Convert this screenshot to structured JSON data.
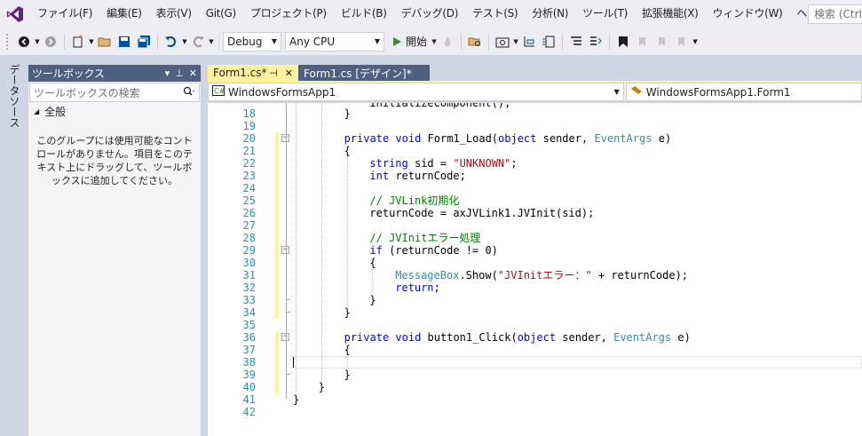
{
  "menu": {
    "items": [
      "ファイル(F)",
      "編集(E)",
      "表示(V)",
      "Git(G)",
      "プロジェクト(P)",
      "ビルド(B)",
      "デバッグ(D)",
      "テスト(S)",
      "分析(N)",
      "ツール(T)",
      "拡張機能(X)",
      "ウィンドウ(W)",
      "ヘルプ(H)"
    ],
    "search_placeholder": "検索 (Ctrl+"
  },
  "toolbar": {
    "configuration": "Debug",
    "platform": "Any CPU",
    "start_label": "開始"
  },
  "side_strip": {
    "data_source_label": "データソース"
  },
  "toolbox": {
    "title": "ツールボックス",
    "search_placeholder": "ツールボックスの検索",
    "group_label": "全般",
    "empty_message": "このグループには使用可能なコントロールがありません。項目をこのテキスト上にドラッグして、ツールボックスに追加してください。"
  },
  "tabs": [
    {
      "label": "Form1.cs*",
      "active": true
    },
    {
      "label": "Form1.cs [デザイン]*",
      "active": false
    }
  ],
  "navbar": {
    "project": "WindowsFormsApp1",
    "class": "WindowsFormsApp1.Form1"
  },
  "editor": {
    "line_numbers": [
      "18",
      "19",
      "20",
      "21",
      "22",
      "23",
      "24",
      "25",
      "26",
      "27",
      "28",
      "29",
      "30",
      "31",
      "32",
      "33",
      "34",
      "35",
      "36",
      "37",
      "38",
      "39",
      "40",
      "41",
      "42"
    ],
    "top_partial_line": "InitializeComponent();",
    "lines": [
      {
        "n": "18",
        "text": "}"
      },
      {
        "n": "19",
        "text": ""
      },
      {
        "n": "20",
        "text": "private void Form1_Load(object sender, EventArgs e)"
      },
      {
        "n": "21",
        "text": "{"
      },
      {
        "n": "22",
        "text": "string sid = \"UNKNOWN\";"
      },
      {
        "n": "23",
        "text": "int returnCode;"
      },
      {
        "n": "24",
        "text": ""
      },
      {
        "n": "25",
        "text": "// JVLink初期化"
      },
      {
        "n": "26",
        "text": "returnCode = axJVLink1.JVInit(sid);"
      },
      {
        "n": "27",
        "text": ""
      },
      {
        "n": "28",
        "text": "// JVInitエラー処理"
      },
      {
        "n": "29",
        "text": "if (returnCode != 0)"
      },
      {
        "n": "30",
        "text": "{"
      },
      {
        "n": "31",
        "text": "MessageBox.Show(\"JVInitエラー：\" + returnCode);"
      },
      {
        "n": "32",
        "text": "return;"
      },
      {
        "n": "33",
        "text": "}"
      },
      {
        "n": "34",
        "text": "}"
      },
      {
        "n": "35",
        "text": ""
      },
      {
        "n": "36",
        "text": "private void button1_Click(object sender, EventArgs e)"
      },
      {
        "n": "37",
        "text": "{"
      },
      {
        "n": "38",
        "text": ""
      },
      {
        "n": "39",
        "text": "}"
      },
      {
        "n": "40",
        "text": "}"
      },
      {
        "n": "41",
        "text": "}"
      },
      {
        "n": "42",
        "text": ""
      }
    ]
  },
  "colors": {
    "tab_active": "#fff29d",
    "tab_inactive": "#4d6082",
    "keyword": "#0000ff",
    "type": "#2b91af",
    "string": "#a31515",
    "comment": "#008000"
  }
}
